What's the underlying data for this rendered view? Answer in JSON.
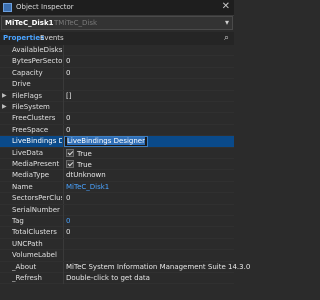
{
  "window": {
    "title": "Object Inspector",
    "close_glyph": "✕"
  },
  "component": {
    "name": "MiTeC_Disk1",
    "type": "TMiTeC_Disk"
  },
  "tabs": {
    "properties": "Properties",
    "events": "Events"
  },
  "icons": {
    "search": "⌕",
    "expand": "▶",
    "dropdown": "▾"
  },
  "properties": [
    {
      "name": "AvailableDisks",
      "value": ""
    },
    {
      "name": "BytesPerSector",
      "value": "0"
    },
    {
      "name": "Capacity",
      "value": "0"
    },
    {
      "name": "Drive",
      "value": ""
    },
    {
      "name": "FileFlags",
      "value": "[]",
      "expandable": true
    },
    {
      "name": "FileSystem",
      "value": "",
      "expandable": true
    },
    {
      "name": "FreeClusters",
      "value": "0"
    },
    {
      "name": "FreeSpace",
      "value": "0"
    },
    {
      "name": "LiveBindings D",
      "value": "LiveBindings Designer",
      "selected": true
    },
    {
      "name": "LiveData",
      "value": "True",
      "checkbox": true
    },
    {
      "name": "MediaPresent",
      "value": "True",
      "checkbox": true
    },
    {
      "name": "MediaType",
      "value": "dtUnknown"
    },
    {
      "name": "Name",
      "value": "MiTeC_Disk1",
      "link": true
    },
    {
      "name": "SectorsPerClus",
      "value": "0"
    },
    {
      "name": "SerialNumber",
      "value": ""
    },
    {
      "name": "Tag",
      "value": "0",
      "link": true
    },
    {
      "name": "TotalClusters",
      "value": "0"
    },
    {
      "name": "UNCPath",
      "value": ""
    },
    {
      "name": "VolumeLabel",
      "value": ""
    },
    {
      "name": "_About",
      "value": "MiTeC System Information Management Suite 14.3.0"
    },
    {
      "name": "_Refresh",
      "value": "Double-click to get data"
    }
  ]
}
